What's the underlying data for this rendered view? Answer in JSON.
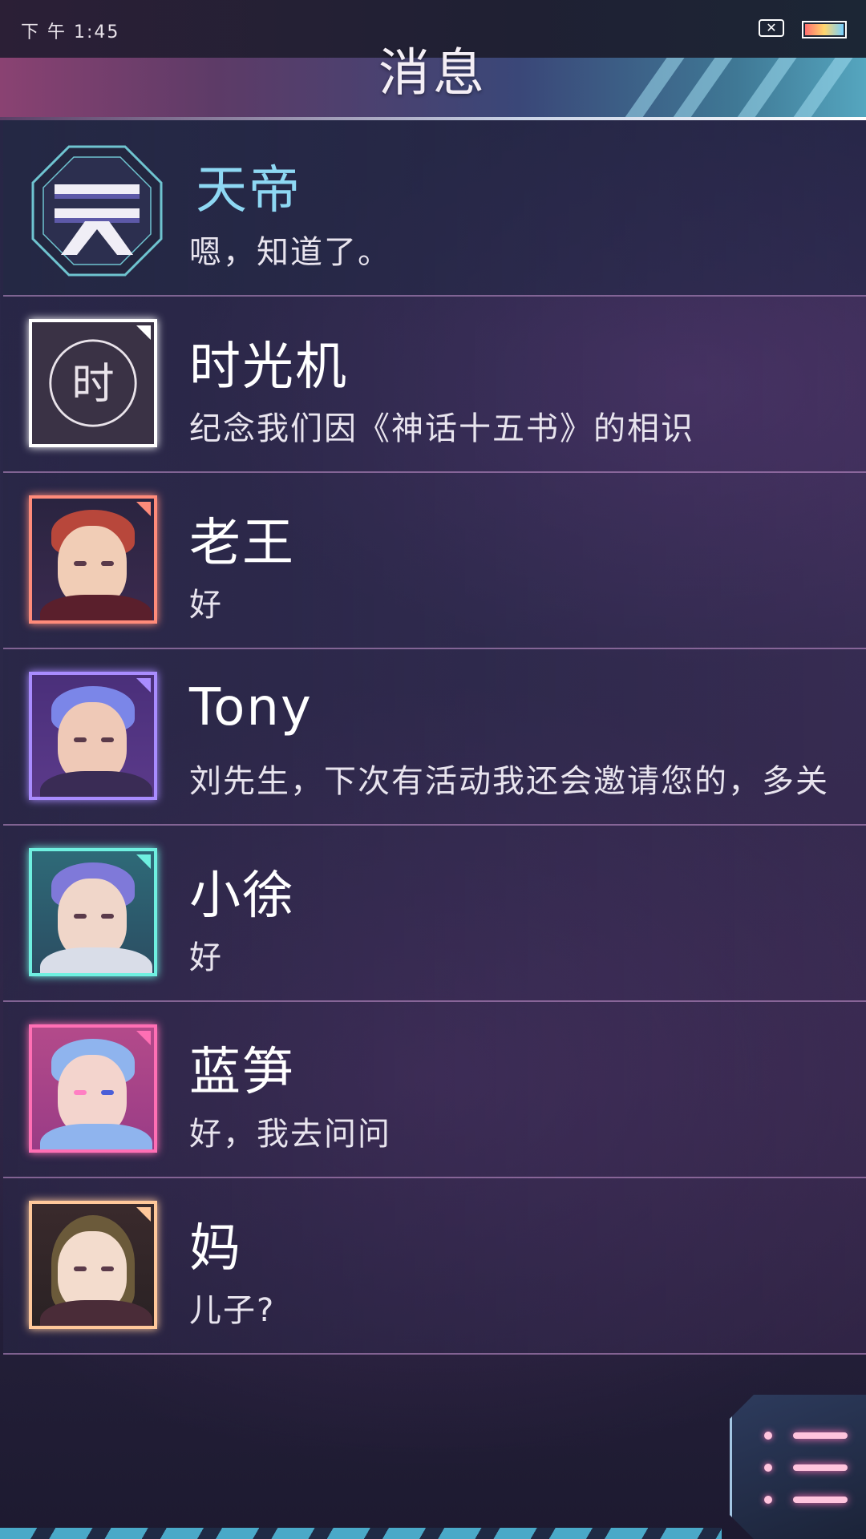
{
  "status_bar": {
    "time": "下 午 1:45",
    "sim_icon": "sim-card-x-icon",
    "battery_icon": "battery-icon"
  },
  "header": {
    "title": "消息"
  },
  "contacts": [
    {
      "name": "天帝",
      "message": "嗯，知道了。",
      "avatar": "tiandi-emblem-icon",
      "accent": "#7fc9d6",
      "name_color": "#8ed8f3"
    },
    {
      "name": "时光机",
      "message": "纪念我们因《神话十五书》的相识",
      "avatar": "shi-seal-icon",
      "accent": "#ffffff"
    },
    {
      "name": "老王",
      "message": "好",
      "avatar": "laowang-avatar",
      "accent": "#ff8b7a"
    },
    {
      "name": "Tony",
      "message": "刘先生，下次有活动我还会邀请您的，多关",
      "avatar": "tony-avatar",
      "accent": "#a98cff"
    },
    {
      "name": "小徐",
      "message": "好",
      "avatar": "xiaoxu-avatar",
      "accent": "#6ff0e0"
    },
    {
      "name": "蓝笋",
      "message": "好，我去问问",
      "avatar": "lansun-avatar",
      "accent": "#ff6fb4"
    },
    {
      "name": "妈",
      "message": "儿子?",
      "avatar": "mom-avatar",
      "accent": "#ffc89a"
    }
  ],
  "menu_button": {
    "icon": "list-menu-icon"
  }
}
